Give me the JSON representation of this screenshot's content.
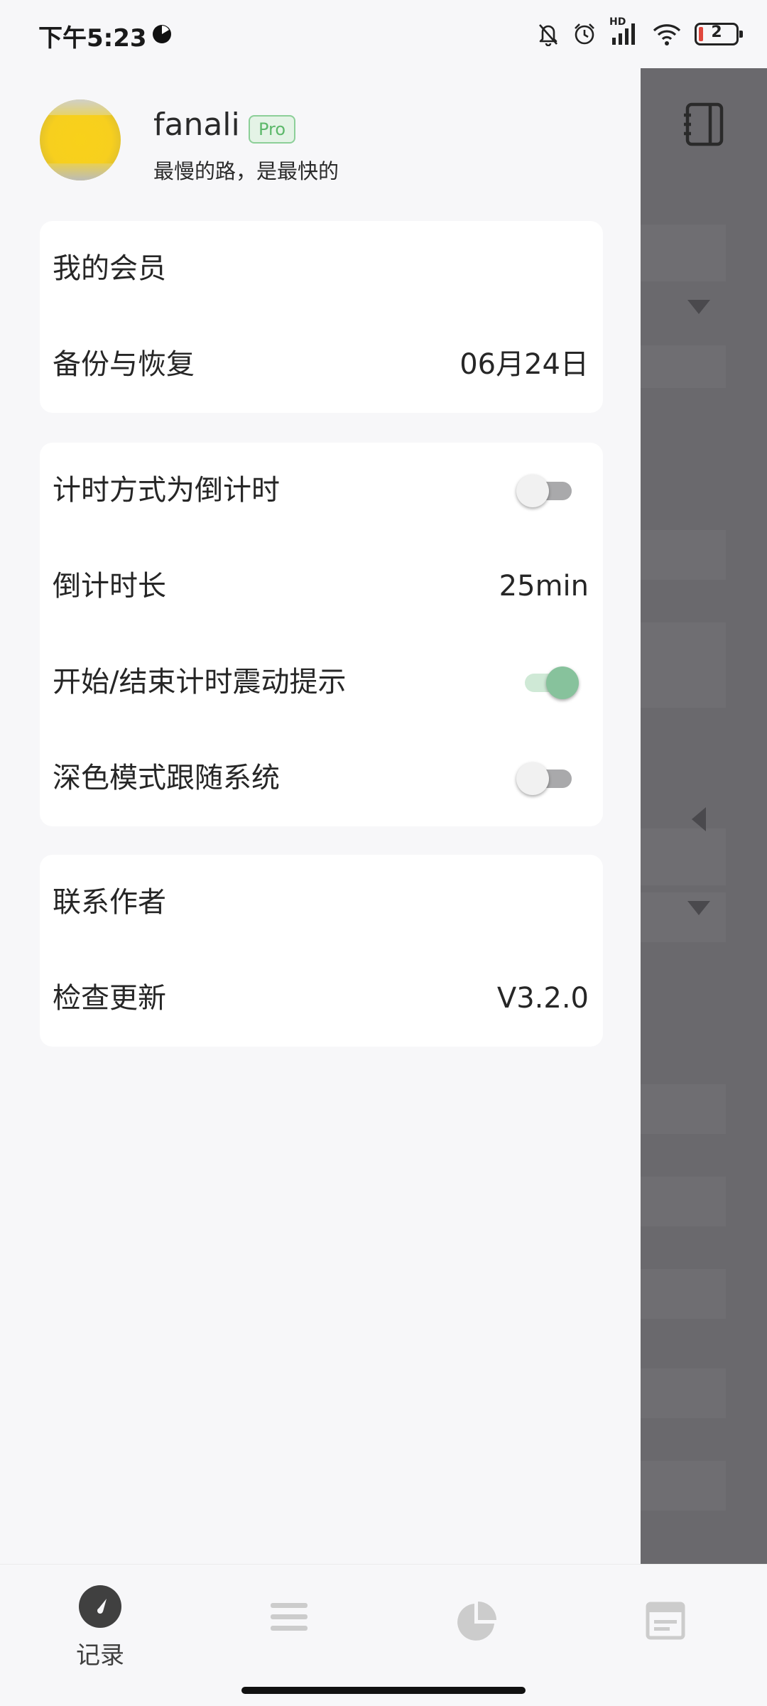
{
  "status_bar": {
    "time": "下午5:23",
    "network": "HD",
    "battery_level": "2",
    "icons": [
      "dnd-moon-icon",
      "bell-off-icon",
      "alarm-icon",
      "signal-icon",
      "wifi-icon",
      "battery-icon"
    ]
  },
  "profile": {
    "name": "fanali",
    "badge": "Pro",
    "motto": "最慢的路，是最快的"
  },
  "group1": {
    "membership": "我的会员",
    "backup_label": "备份与恢复",
    "backup_value": "06月24日"
  },
  "group2": {
    "countdown_mode_label": "计时方式为倒计时",
    "countdown_mode_on": false,
    "countdown_duration_label": "倒计时长",
    "countdown_duration_value": "25min",
    "vibration_label": "开始/结束计时震动提示",
    "vibration_on": true,
    "dark_mode_label": "深色模式跟随系统",
    "dark_mode_on": false
  },
  "group3": {
    "contact_label": "联系作者",
    "update_label": "检查更新",
    "update_value": "V3.2.0"
  },
  "bottom_nav": {
    "items": [
      {
        "label": "记录",
        "icon": "gauge-icon",
        "active": true
      },
      {
        "label": "",
        "icon": "list-icon",
        "active": false
      },
      {
        "label": "",
        "icon": "pie-chart-icon",
        "active": false
      },
      {
        "label": "",
        "icon": "card-icon",
        "active": false
      }
    ]
  },
  "colors": {
    "accent_green": "#87c29c",
    "badge_green": "#5cb86a",
    "overlay": "#6a696d",
    "card": "#ffffff",
    "background": "#f7f7f9"
  }
}
